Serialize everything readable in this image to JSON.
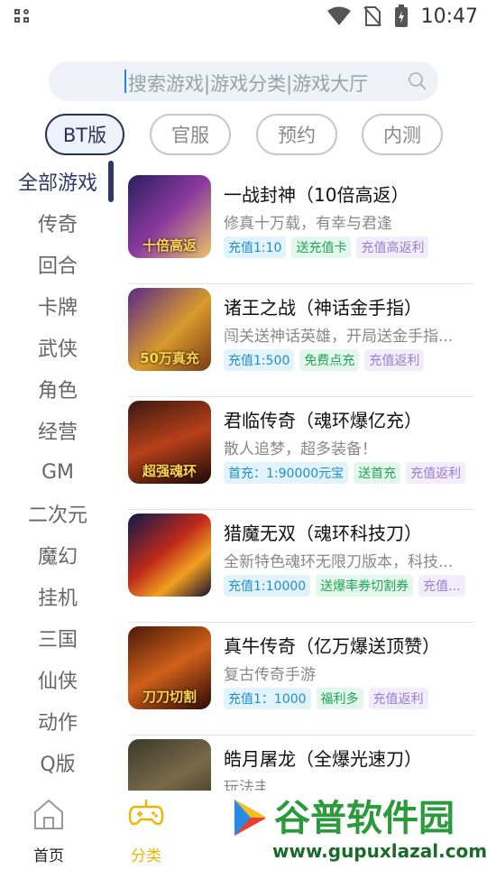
{
  "status": {
    "time": "10:47"
  },
  "search": {
    "placeholder": "搜索游戏|游戏分类|游戏大厅"
  },
  "tabs": [
    {
      "label": "BT版",
      "active": true
    },
    {
      "label": "官服",
      "active": false
    },
    {
      "label": "预约",
      "active": false
    },
    {
      "label": "内测",
      "active": false
    }
  ],
  "sidebar": [
    {
      "label": "全部游戏",
      "active": true
    },
    {
      "label": "传奇"
    },
    {
      "label": "回合"
    },
    {
      "label": "卡牌"
    },
    {
      "label": "武侠"
    },
    {
      "label": "角色"
    },
    {
      "label": "经营"
    },
    {
      "label": "GM"
    },
    {
      "label": "二次元"
    },
    {
      "label": "魔幻"
    },
    {
      "label": "挂机"
    },
    {
      "label": "三国"
    },
    {
      "label": "仙侠"
    },
    {
      "label": "动作"
    },
    {
      "label": "Q版"
    }
  ],
  "games": [
    {
      "title": "一战封神（10倍高返）",
      "desc": "修真十万载，有幸与君逢",
      "thumb_caption": "十倍高返",
      "tags": [
        "充值1:10",
        "送充值卡",
        "充值高返利"
      ]
    },
    {
      "title": "诸王之战（神话金手指）",
      "desc": "闯关送神话英雄，开局送金手指...",
      "thumb_caption": "50万真充",
      "tags": [
        "充值1:500",
        "免费点充",
        "充值返利"
      ]
    },
    {
      "title": "君临传奇（魂环爆亿充）",
      "desc": "散人追梦，超多装备！",
      "thumb_caption": "超强魂环",
      "tags": [
        "首充：1:90000元宝",
        "送首充",
        "充值返利"
      ]
    },
    {
      "title": "猎魔无双（魂环科技刀）",
      "desc": "全新特色魂环无限刀版本，科技...",
      "thumb_caption": "",
      "tags": [
        "充值1:10000",
        "送爆率券切割券",
        "充值..."
      ]
    },
    {
      "title": "真牛传奇（亿万爆送顶赞）",
      "desc": "复古传奇手游",
      "thumb_caption": "刀刀切割",
      "tags": [
        "充值1：1000",
        "福利多",
        "充值返利"
      ]
    },
    {
      "title": "皓月屠龙（全爆光速刀）",
      "desc": "玩法丰富传奇手游，添加全新激",
      "thumb_caption": "",
      "tags": []
    }
  ],
  "bottom_nav": [
    {
      "label": "首页",
      "active": false
    },
    {
      "label": "分类",
      "active": true
    }
  ],
  "colors": {
    "accent": "#2f3a6b",
    "nav_active": "#f0b400"
  }
}
